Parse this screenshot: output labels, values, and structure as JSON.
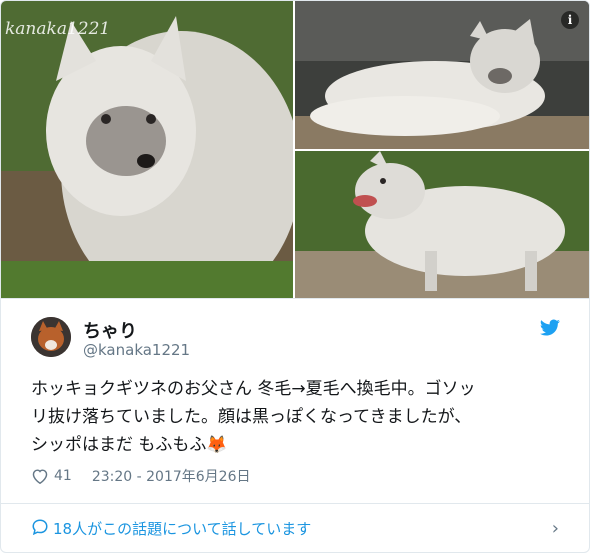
{
  "photos": {
    "watermark": "kanaka1221",
    "info_icon": "info-icon"
  },
  "user": {
    "name": "ちゃり",
    "handle": "@kanaka1221"
  },
  "tweet": {
    "text_line1": "ホッキョクギツネのお父さん 冬毛→夏毛へ換毛中。ゴソッ",
    "text_line2": "リ抜け落ちていました。顔は黒っぽくなってきましたが、",
    "text_line3": "シッポはまだ もふもふ🦊",
    "likes": "41",
    "timestamp": "23:20 - 2017年6月26日"
  },
  "footer": {
    "conversation": "18人がこの話題について話しています"
  },
  "colors": {
    "accent": "#1b95e0",
    "muted": "#657786",
    "text": "#14171a"
  }
}
